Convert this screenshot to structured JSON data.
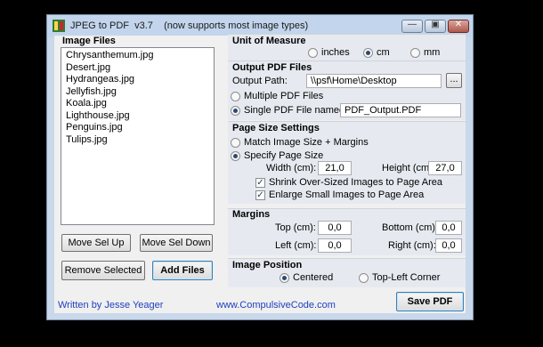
{
  "window": {
    "title": "JPEG to PDF  v3.7    (now supports most image types)",
    "minimize_glyph": "—",
    "restore_glyph": "▣",
    "close_glyph": "✕"
  },
  "files": {
    "header": "Image Files",
    "items": [
      "Chrysanthemum.jpg",
      "Desert.jpg",
      "Hydrangeas.jpg",
      "Jellyfish.jpg",
      "Koala.jpg",
      "Lighthouse.jpg",
      "Penguins.jpg",
      "Tulips.jpg"
    ],
    "move_up": "Move Sel Up",
    "move_down": "Move Sel Down",
    "remove": "Remove Selected",
    "add": "Add Files"
  },
  "units": {
    "header": "Unit of Measure",
    "inches": "inches",
    "cm": "cm",
    "mm": "mm",
    "selected": "cm"
  },
  "output": {
    "header": "Output PDF Files",
    "path_label": "Output Path:",
    "path_value": "\\\\psf\\Home\\Desktop",
    "browse": "...",
    "multiple": "Multiple PDF Files",
    "single": "Single PDF File named:",
    "single_value": "PDF_Output.PDF",
    "selected": "single"
  },
  "page_size": {
    "header": "Page Size Settings",
    "match": "Match Image Size + Margins",
    "specify": "Specify Page Size",
    "selected": "specify",
    "width_label": "Width (cm):",
    "width_value": "21,0",
    "height_label": "Height (cm):",
    "height_value": "27,0",
    "shrink": "Shrink Over-Sized Images to Page Area",
    "enlarge": "Enlarge Small Images to Page Area",
    "check_glyph": "✓"
  },
  "margins": {
    "header": "Margins",
    "top_label": "Top (cm):",
    "top_value": "0,0",
    "bottom_label": "Bottom (cm):",
    "bottom_value": "0,0",
    "left_label": "Left (cm):",
    "left_value": "0,0",
    "right_label": "Right (cm):",
    "right_value": "0,0"
  },
  "position": {
    "header": "Image Position",
    "centered": "Centered",
    "topleft": "Top-Left Corner",
    "selected": "centered"
  },
  "footer": {
    "author": "Written by Jesse Yeager",
    "website": "www.CompulsiveCode.com",
    "save": "Save PDF"
  },
  "colors": {
    "link": "#1f3fbf",
    "titlebar": "#c2d5ec",
    "group_bg": "#e6eaf0"
  }
}
